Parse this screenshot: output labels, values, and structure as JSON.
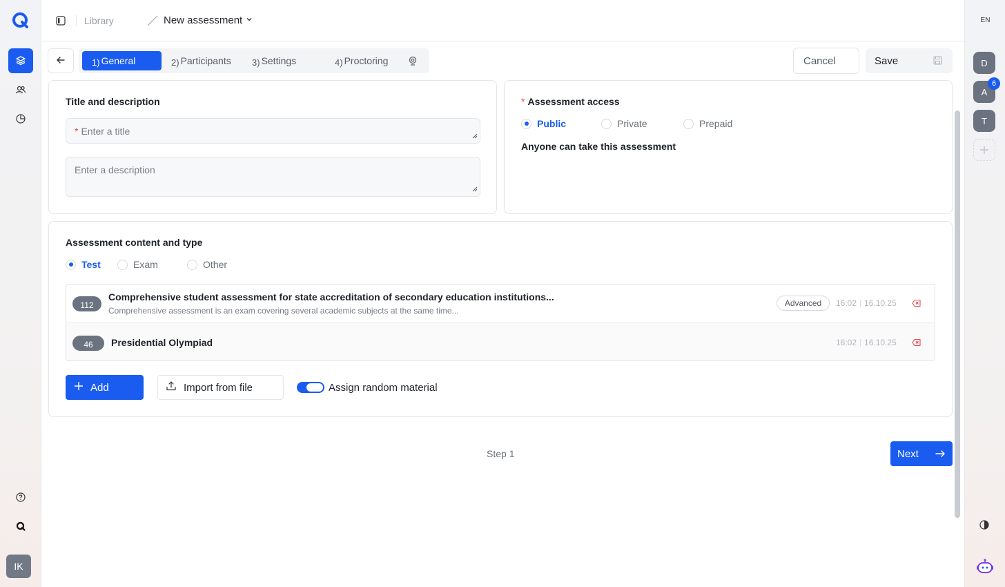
{
  "breadcrumb": {
    "library": "Library",
    "current": "New assessment"
  },
  "tabs": [
    {
      "num": "1)",
      "label": "General"
    },
    {
      "num": "2)",
      "label": "Participants"
    },
    {
      "num": "3)",
      "label": "Settings"
    },
    {
      "num": "4)",
      "label": "Proctoring"
    }
  ],
  "actions": {
    "cancel": "Cancel",
    "save": "Save"
  },
  "general": {
    "section_title": "Title and description",
    "required_mark": "*",
    "title_placeholder": "Enter a title",
    "description_placeholder": "Enter a description"
  },
  "access": {
    "section_title": "Assessment access",
    "options": [
      "Public",
      "Private",
      "Prepaid"
    ],
    "selected": "Public",
    "description": "Anyone can take this assessment"
  },
  "content": {
    "section_title": "Assessment content and type",
    "types": [
      "Test",
      "Exam",
      "Other"
    ],
    "selected": "Test",
    "materials": [
      {
        "count": "112",
        "title": "Comprehensive student assessment for state accreditation of secondary education institutions...",
        "subtitle": "Comprehensive assessment is an exam covering several academic subjects at the same time...",
        "level": "Advanced",
        "time": "16:02",
        "date": "16.10.25"
      },
      {
        "count": "46",
        "title": "Presidential Olympiad",
        "subtitle": "",
        "level": "",
        "time": "16:02",
        "date": "16.10.25"
      }
    ],
    "add_label": "Add",
    "import_label": "Import from file",
    "toggle_label": "Assign random material",
    "toggle_on": true
  },
  "footer": {
    "step": "Step 1",
    "next": "Next"
  },
  "right_rail": {
    "lang": "EN",
    "users": [
      "D",
      "A",
      "T"
    ],
    "notification_count": "6"
  },
  "left_rail": {
    "user_initials": "IK"
  },
  "colors": {
    "accent": "#1a5cf0",
    "danger": "#e5484d",
    "border": "#e3e5e8"
  },
  "icons": [
    "logo-icon",
    "layers-icon",
    "users-icon",
    "chart-icon",
    "help-icon",
    "brand-icon",
    "sidebar-toggle-icon",
    "chevron-down-icon",
    "arrow-left-icon",
    "proctoring-icon",
    "save-icon",
    "plus-icon",
    "upload-icon",
    "remove-icon",
    "arrow-right-icon",
    "theme-icon",
    "assistant-icon"
  ]
}
